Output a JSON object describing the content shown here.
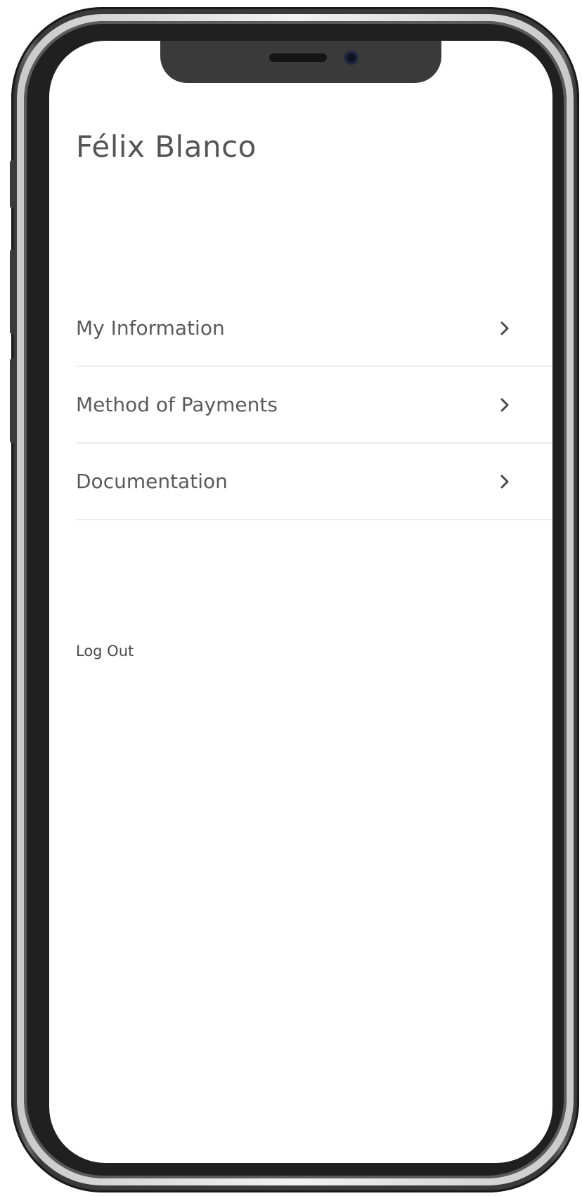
{
  "profile": {
    "user_name": "Félix Blanco"
  },
  "menu": {
    "items": [
      {
        "label": "My Information",
        "icon": "chevron-right-icon"
      },
      {
        "label": "Method of Payments",
        "icon": "chevron-right-icon"
      },
      {
        "label": "Documentation",
        "icon": "chevron-right-icon"
      }
    ]
  },
  "actions": {
    "logout_label": "Log Out"
  }
}
